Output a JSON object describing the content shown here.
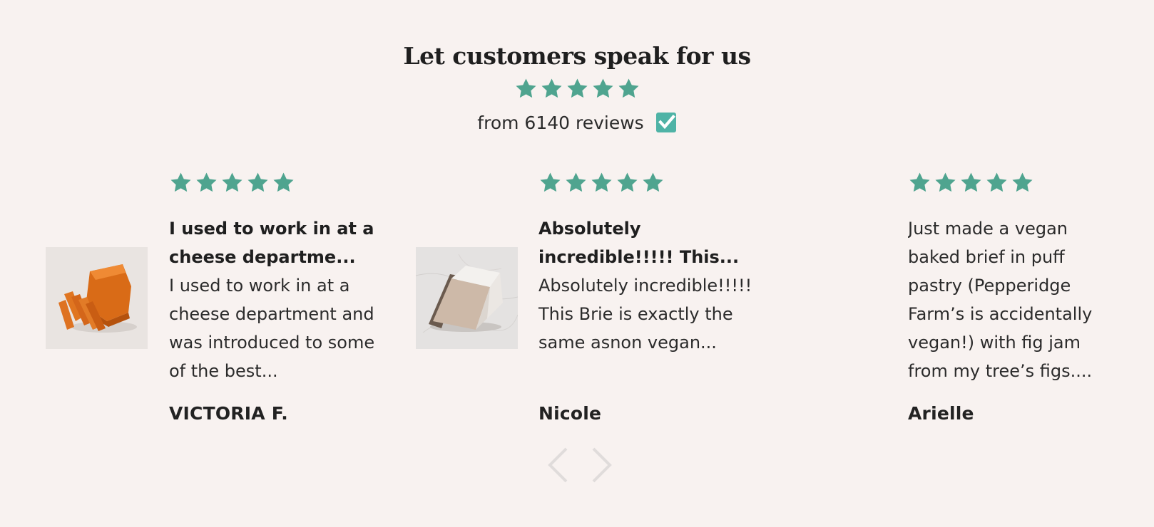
{
  "section": {
    "heading": "Let customers speak for us",
    "rating": 5,
    "summary_text": "from 6140 reviews",
    "verified_icon": "verified-check-icon"
  },
  "colors": {
    "background": "#f8f2f0",
    "star": "#4fa48f",
    "verified": "#4fb3a6",
    "nav_arrow": "#e0dcdb"
  },
  "reviews": [
    {
      "rating": 5,
      "title": "I used to work in at a cheese departme...",
      "text": "I used to work in at a cheese department and was introduced to some of the best...",
      "author": "VICTORIA F.",
      "image": "orange-cheese-photo"
    },
    {
      "rating": 5,
      "title": "Absolutely incredible!!!!! This...",
      "text": "Absolutely incredible!!!!! This Brie is exactly the same asnon vegan...",
      "author": "Nicole",
      "image": "brie-wedge-photo"
    },
    {
      "rating": 5,
      "title": "",
      "text": "Just made a vegan baked brief in puff pastry (Pepperidge Farm’s is accidentally vegan!) with fig jam from my tree’s figs....",
      "author": "Arielle",
      "image": ""
    }
  ],
  "navigation": {
    "prev_icon": "chevron-left-icon",
    "next_icon": "chevron-right-icon"
  }
}
